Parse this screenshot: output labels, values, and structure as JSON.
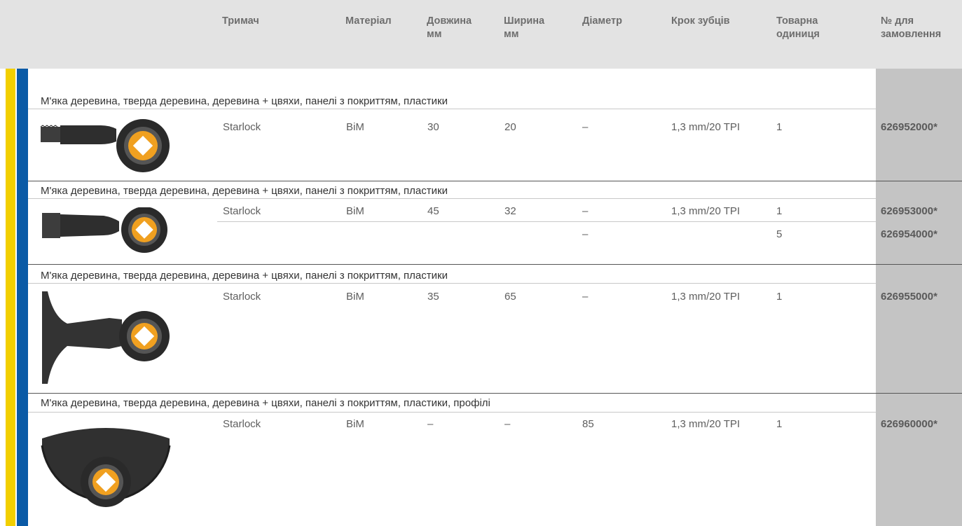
{
  "headers": {
    "holder": "Тримач",
    "material": "Матеріал",
    "length_1": "Довжина",
    "length_2": "мм",
    "width_1": "Ширина",
    "width_2": "мм",
    "diameter": "Діаметр",
    "tooth_pitch": "Крок зубців",
    "unit_1": "Товарна",
    "unit_2": "одиниця",
    "order_1": "№ для",
    "order_2": "замовлення"
  },
  "colors": {
    "yellow": "#f2cf00",
    "blue": "#0a5aa6",
    "header_bg": "#e3e3e3",
    "order_bg": "#c4c4c4"
  },
  "sections": [
    {
      "application": "М'яка деревина, тверда деревина, деревина + цвяхи, панелі з покриттям, пластики",
      "image": "narrow-plunge-blade-icon",
      "rows": [
        {
          "holder": "Starlock",
          "material": "BiM",
          "length": "30",
          "width": "20",
          "diameter": "–",
          "pitch": "1,3 mm/20 TPI",
          "unit": "1",
          "order": "626952000*"
        }
      ]
    },
    {
      "application": "М'яка деревина, тверда деревина, деревина + цвяхи, панелі з покриттям, пластики",
      "image": "medium-plunge-blade-icon",
      "rows": [
        {
          "holder": "Starlock",
          "material": "BiM",
          "length": "45",
          "width": "32",
          "diameter": "–",
          "pitch": "1,3 mm/20 TPI",
          "unit": "1",
          "order": "626953000*"
        },
        {
          "holder": "",
          "material": "",
          "length": "",
          "width": "",
          "diameter": "–",
          "pitch": "",
          "unit": "5",
          "order": "626954000*"
        }
      ]
    },
    {
      "application": "М'яка деревина, тверда деревина, деревина + цвяхи, панелі з покриттям, пластики",
      "image": "wide-plunge-blade-icon",
      "rows": [
        {
          "holder": "Starlock",
          "material": "BiM",
          "length": "35",
          "width": "65",
          "diameter": "–",
          "pitch": "1,3 mm/20 TPI",
          "unit": "1",
          "order": "626955000*"
        }
      ]
    },
    {
      "application": "М'яка деревина, тверда деревина, деревина + цвяхи, панелі з покриттям, пластики, профілі",
      "image": "segment-saw-blade-icon",
      "rows": [
        {
          "holder": "Starlock",
          "material": "BiM",
          "length": "–",
          "width": "–",
          "diameter": "85",
          "pitch": "1,3 mm/20 TPI",
          "unit": "1",
          "order": "626960000*"
        }
      ]
    }
  ]
}
